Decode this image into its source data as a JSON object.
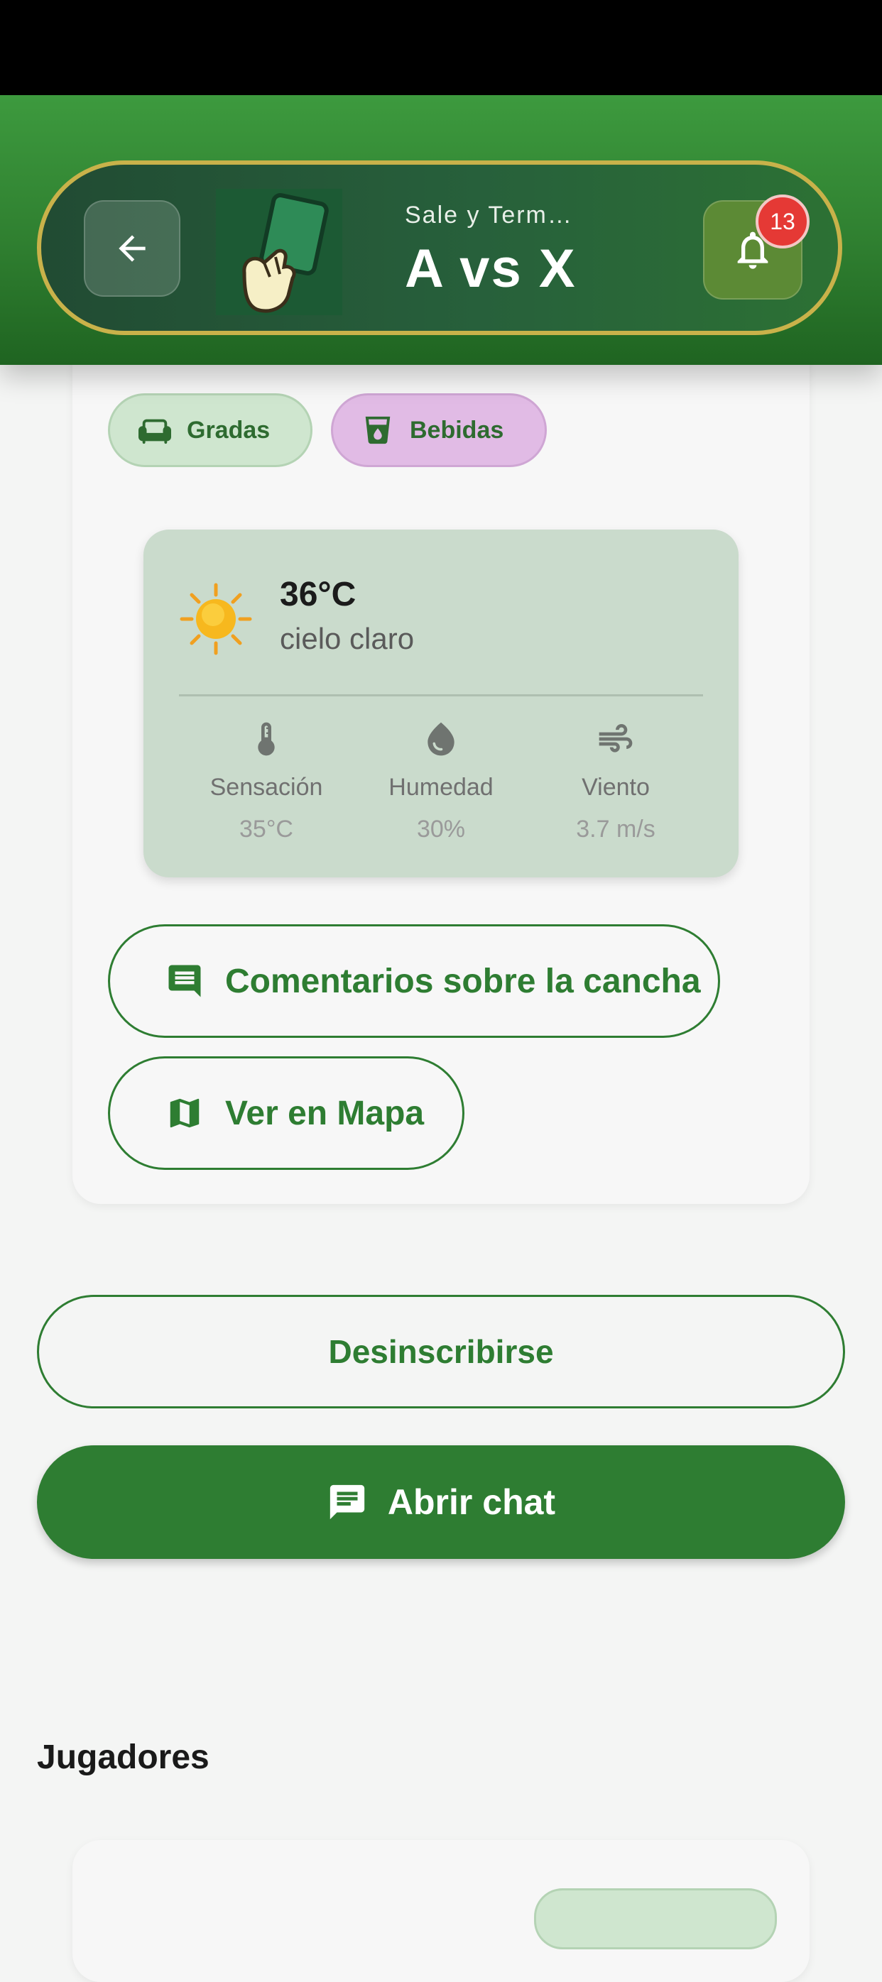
{
  "header": {
    "subtitle": "Sale y Termi…",
    "title": "A vs X",
    "notification_count": "13"
  },
  "amenities": [
    {
      "label": "Gradas",
      "icon": "sofa-icon",
      "color": "#cfe6cf"
    },
    {
      "label": "Bebidas",
      "icon": "cup-icon",
      "color": "#e1bbe5"
    }
  ],
  "weather": {
    "temperature": "36°C",
    "description": "cielo claro",
    "icon": "sun-icon",
    "metrics": [
      {
        "label": "Sensación",
        "value": "35°C",
        "icon": "thermometer-icon"
      },
      {
        "label": "Humedad",
        "value": "30%",
        "icon": "droplet-icon"
      },
      {
        "label": "Viento",
        "value": "3.7 m/s",
        "icon": "wind-icon"
      }
    ]
  },
  "actions": {
    "comments_label": "Comentarios sobre la cancha",
    "map_label": "Ver en Mapa",
    "unsubscribe_label": "Desinscribirse",
    "chat_label": "Abrir chat"
  },
  "sections": {
    "players_title": "Jugadores"
  },
  "colors": {
    "primary": "#2e7d32",
    "header_border": "#c9b24a",
    "badge": "#e53935"
  }
}
